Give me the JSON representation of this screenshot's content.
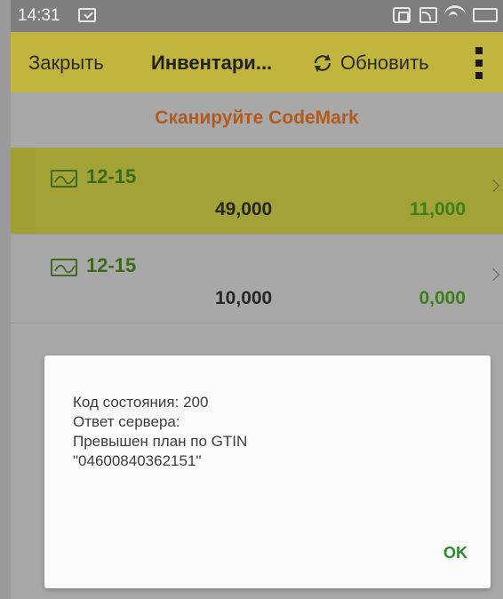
{
  "status_bar": {
    "time": "14:31",
    "icons": [
      "notification-check-icon",
      "nfc-icon",
      "cast-icon",
      "wifi-icon",
      "battery-icon"
    ]
  },
  "toolbar": {
    "close_label": "Закрыть",
    "title": "Инвентари...",
    "refresh_label": "Обновить",
    "icons": [
      "refresh-icon",
      "overflow-menu-icon"
    ],
    "background_color": "#c1b53d"
  },
  "scan_hint": {
    "text": "Сканируйте CodeMark",
    "color": "#b25a1e"
  },
  "list": {
    "items": [
      {
        "title": "12-15",
        "quantity": "49,000",
        "fact": "11,000",
        "selected": true
      },
      {
        "title": "12-15",
        "quantity": "10,000",
        "fact": "0,000",
        "selected": false
      }
    ],
    "item_icon": "wave-chart-icon",
    "title_color": "#3b6b1a",
    "fact_color": "#3b7f1a"
  },
  "dialog": {
    "lines": [
      "Код состояния: 200",
      "Ответ сервера:",
      "Превышен план по GTIN",
      "\"04600840362151\""
    ],
    "ok_label": "OK",
    "ok_color": "#2b8a2b"
  }
}
